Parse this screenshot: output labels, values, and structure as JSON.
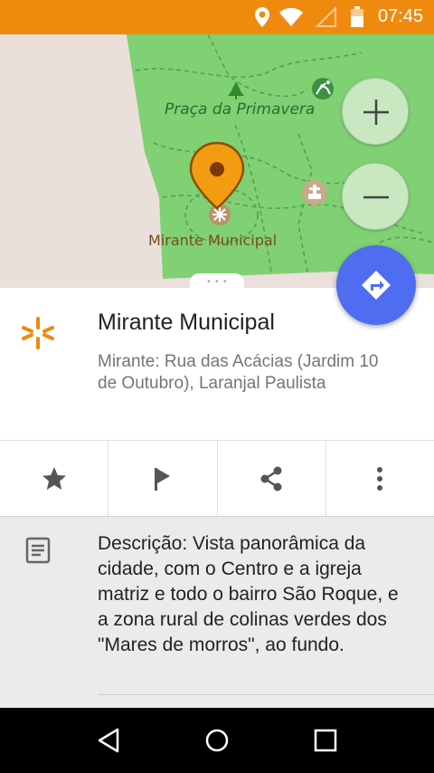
{
  "status_bar": {
    "time": "07:45",
    "icons": [
      "location-icon",
      "wifi-icon",
      "signal-icon",
      "battery-icon"
    ],
    "background": "#ef8a0f"
  },
  "map": {
    "park_label": "Praça da Primavera",
    "poi_label": "Mirante Municipal",
    "park_color": "#7fd173",
    "land_color": "#eadfdb",
    "pin_color": "#f39c12",
    "controls": {
      "zoom_in": "plus-icon",
      "zoom_out": "minus-icon",
      "directions": "directions-icon"
    }
  },
  "place": {
    "title": "Mirante Municipal",
    "address": "Mirante: Rua das Acácias (Jardim 10 de Outubro), Laranjal Paulista",
    "icon": "viewpoint-icon",
    "accent": "#ef8a0f"
  },
  "actions": [
    {
      "name": "favorite",
      "icon": "star-icon"
    },
    {
      "name": "report",
      "icon": "flag-icon"
    },
    {
      "name": "share",
      "icon": "share-icon"
    },
    {
      "name": "more",
      "icon": "more-vert-icon"
    }
  ],
  "details": {
    "description": "Descrição: Vista panorâmica da cidade, com o Centro e a igreja matriz e todo o bairro São Roque, e a zona rural de colinas verdes dos \"Mares de morros\", ao fundo.",
    "icon": "document-icon"
  },
  "nav_bar": {
    "buttons": [
      "back-icon",
      "home-icon",
      "recents-icon"
    ]
  }
}
